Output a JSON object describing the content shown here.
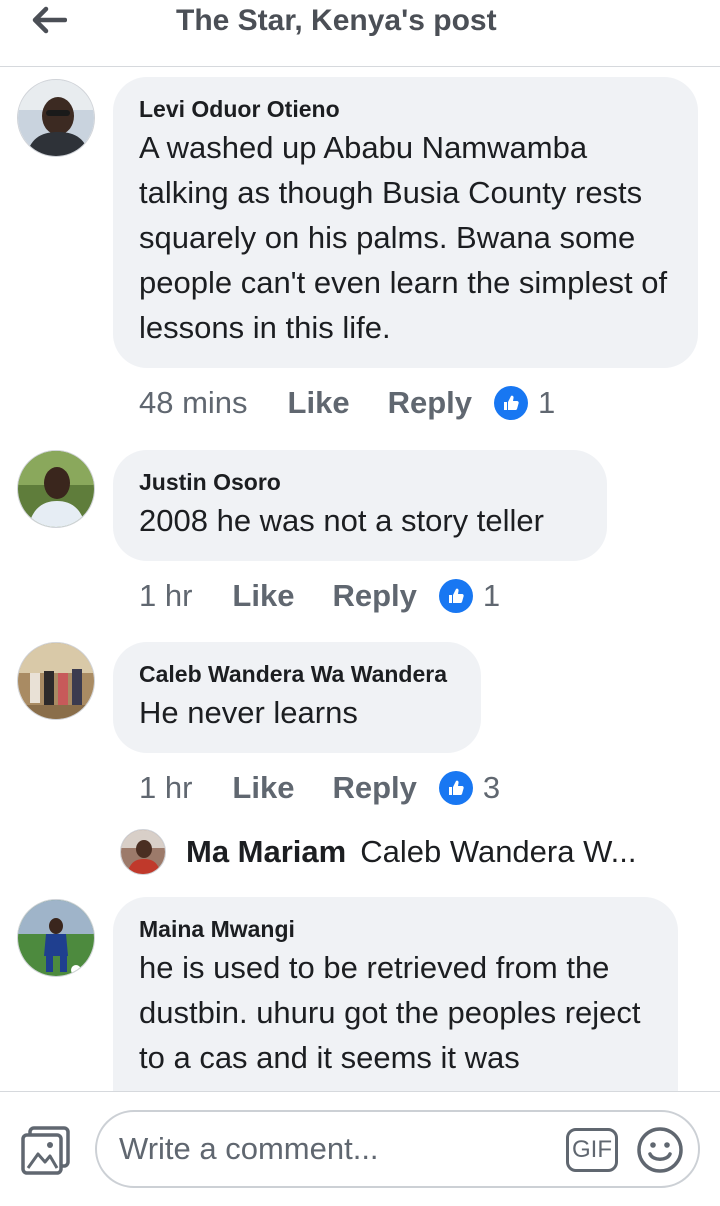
{
  "header": {
    "title": "The Star, Kenya's post"
  },
  "comments": [
    {
      "author": "Levi Oduor Otieno",
      "text": "A washed up Ababu Namwamba talking as though Busia County rests squarely on his palms. Bwana some people can't even learn the simplest of lessons in this life.",
      "time": "48 mins",
      "like_label": "Like",
      "reply_label": "Reply",
      "reactions": "1"
    },
    {
      "author": "Justin Osoro",
      "text": "2008 he was not a story teller",
      "time": "1 hr",
      "like_label": "Like",
      "reply_label": "Reply",
      "reactions": "1"
    },
    {
      "author": "Caleb Wandera Wa Wandera",
      "text": "He never learns",
      "time": "1 hr",
      "like_label": "Like",
      "reply_label": "Reply",
      "reactions": "3",
      "reply_preview": {
        "author": "Ma Mariam",
        "text": "Caleb Wandera W..."
      }
    },
    {
      "author": "Maina Mwangi",
      "text": "he is used to be retrieved from the dustbin. uhuru got the peoples reject to a cas and it seems it was"
    }
  ],
  "composer": {
    "placeholder": "Write a comment...",
    "gif_label": "GIF"
  },
  "colors": {
    "like_blue": "#1877f2",
    "bubble_bg": "#f0f2f5",
    "meta_gray": "#606770"
  }
}
